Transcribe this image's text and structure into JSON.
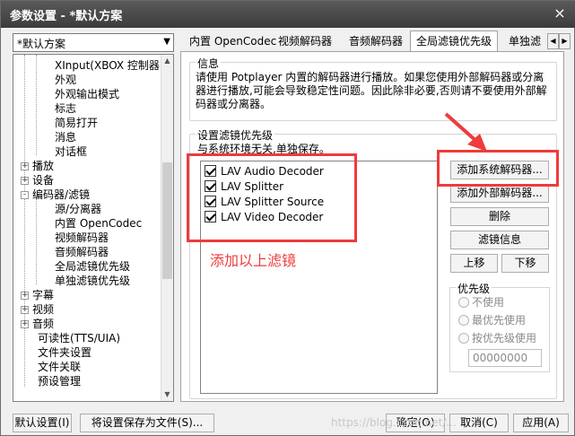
{
  "window": {
    "title": "参数设置 - *默认方案",
    "close_icon": "×"
  },
  "preset": {
    "selected": "*默认方案"
  },
  "tree": {
    "items": [
      {
        "label": "XInput(XBOX 控制器)",
        "level": 2
      },
      {
        "label": "外观",
        "level": 2
      },
      {
        "label": "外观输出模式",
        "level": 2
      },
      {
        "label": "标志",
        "level": 2
      },
      {
        "label": "简易打开",
        "level": 2
      },
      {
        "label": "消息",
        "level": 2
      },
      {
        "label": "对话框",
        "level": 2
      },
      {
        "label": "播放",
        "level": 1,
        "expander": "+"
      },
      {
        "label": "设备",
        "level": 1,
        "expander": "+"
      },
      {
        "label": "编码器/滤镜",
        "level": 1,
        "expander": "-"
      },
      {
        "label": "源/分离器",
        "level": 2
      },
      {
        "label": "内置 OpenCodec",
        "level": 2
      },
      {
        "label": "视频解码器",
        "level": 2
      },
      {
        "label": "音频解码器",
        "level": 2
      },
      {
        "label": "全局滤镜优先级",
        "level": 2
      },
      {
        "label": "单独滤镜优先级",
        "level": 2
      },
      {
        "label": "字幕",
        "level": 1,
        "expander": "+"
      },
      {
        "label": "视频",
        "level": 1,
        "expander": "+"
      },
      {
        "label": "音频",
        "level": 1,
        "expander": "+"
      },
      {
        "label": "可读性(TTS/UIA)",
        "level": 1
      },
      {
        "label": "文件夹设置",
        "level": 1
      },
      {
        "label": "文件关联",
        "level": 1
      },
      {
        "label": "预设管理",
        "level": 1
      }
    ]
  },
  "tabs": [
    {
      "label": "内置 OpenCodec"
    },
    {
      "label": "视频解码器"
    },
    {
      "label": "音频解码器"
    },
    {
      "label": "全局滤镜优先级",
      "active": true
    },
    {
      "label": "单独滤"
    }
  ],
  "info": {
    "title": "信息",
    "text": "请使用 Potplayer 内置的解码器进行播放。如果您使用外部解码器或分离器进行播放,可能会导致稳定性问题。因此除非必要,否则请不要使用外部解码器或分离器。"
  },
  "priority_section": {
    "title": "设置滤镜优先级",
    "subtitle": "与系统环境无关,单独保存。",
    "filters": [
      {
        "label": "LAV Audio Decoder",
        "checked": true
      },
      {
        "label": "LAV Splitter",
        "checked": true
      },
      {
        "label": "LAV Splitter Source",
        "checked": true
      },
      {
        "label": "LAV Video Decoder",
        "checked": true
      }
    ],
    "buttons": {
      "add_system": "添加系统解码器...",
      "add_external": "添加外部解码器...",
      "delete": "删除",
      "filter_info": "滤镜信息",
      "move_up": "上移",
      "move_down": "下移"
    },
    "priority": {
      "title": "优先级",
      "options": [
        "不使用",
        "最优先使用",
        "按优先级使用"
      ],
      "value": "00000000"
    }
  },
  "annotation": {
    "text": "添加以上滤镜",
    "color": "#ee3b3b"
  },
  "footer": {
    "default": "默认设置(I)",
    "save_to_file": "将设置保存为文件(S)...",
    "ok": "确定(O)",
    "cancel": "取消(C)",
    "apply": "应用(A)"
  },
  "watermark": "https://blog.csdn.net/..."
}
